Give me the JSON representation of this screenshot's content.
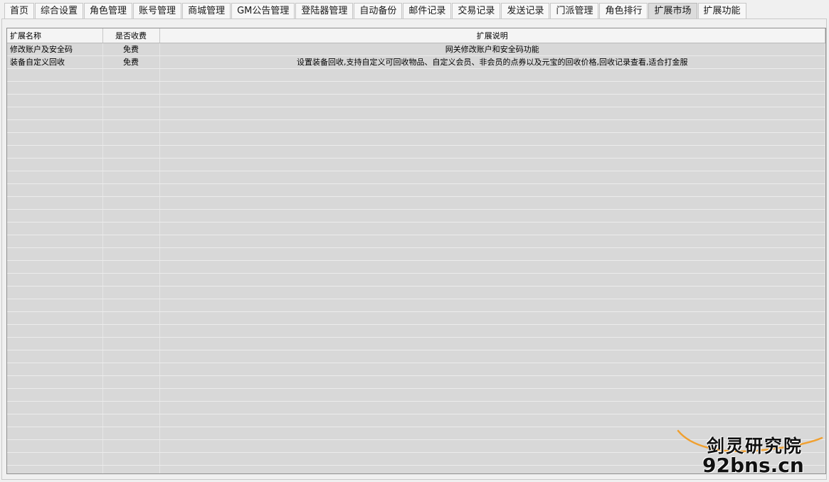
{
  "tabs": [
    {
      "label": "首页",
      "active": false
    },
    {
      "label": "综合设置",
      "active": false
    },
    {
      "label": "角色管理",
      "active": false
    },
    {
      "label": "账号管理",
      "active": false
    },
    {
      "label": "商城管理",
      "active": false
    },
    {
      "label": "GM公告管理",
      "active": false
    },
    {
      "label": "登陆器管理",
      "active": false
    },
    {
      "label": "自动备份",
      "active": false
    },
    {
      "label": "邮件记录",
      "active": false
    },
    {
      "label": "交易记录",
      "active": false
    },
    {
      "label": "发送记录",
      "active": false
    },
    {
      "label": "门派管理",
      "active": false
    },
    {
      "label": "角色排行",
      "active": false
    },
    {
      "label": "扩展市场",
      "active": true
    },
    {
      "label": "扩展功能",
      "active": false
    }
  ],
  "table": {
    "columns": [
      "扩展名称",
      "是否收费",
      "扩展说明"
    ],
    "rows": [
      [
        "修改账户及安全码",
        "免费",
        "网关修改账户和安全码功能"
      ],
      [
        "装备自定义回收",
        "免费",
        "设置装备回收,支持自定义可回收物品、自定义会员、非会员的点券以及元宝的回收价格,回收记录查看,适合打金服"
      ]
    ]
  },
  "watermark": {
    "line1": "剑灵研究院",
    "line2": "92bns.cn"
  },
  "colors": {
    "row_bg": "#d8d8d8",
    "header_bg": "#f4f4f4",
    "active_tab_bg": "#dcdcdc",
    "swoosh": "#f0a030"
  }
}
